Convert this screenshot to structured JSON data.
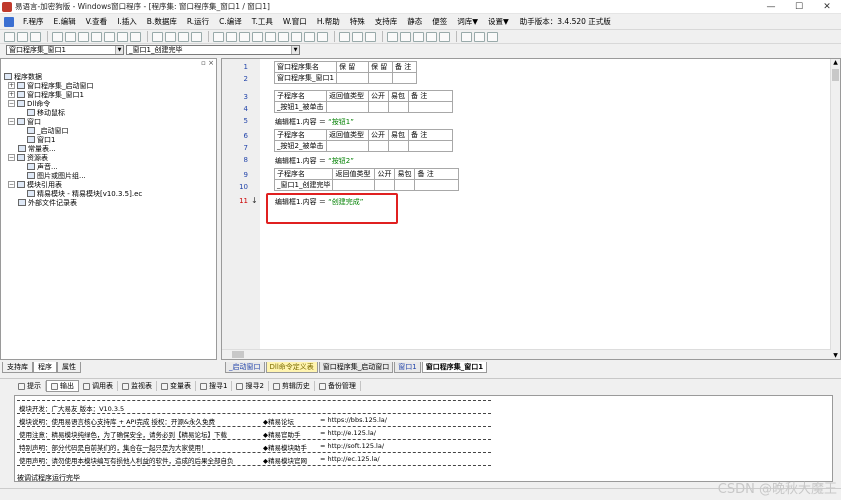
{
  "window": {
    "title": "易语言-加密狗版 - Windows窗口程序 - [程序集: 窗口程序集_窗口1 / 窗口1]",
    "minimize": "—",
    "maximize": "☐",
    "close": "✕"
  },
  "menu": {
    "items": [
      "F.程序",
      "E.编辑",
      "V.查看",
      "I.插入",
      "B.数据库",
      "R.运行",
      "C.编译",
      "T.工具",
      "W.窗口",
      "H.帮助",
      "特殊",
      "支持库",
      "静态",
      "便签",
      "词库▼",
      "设置▼"
    ],
    "version": "助手版本：3.4.520 正式版"
  },
  "combos": {
    "assembly": "窗口程序集_窗口1",
    "subroutine": "_窗口1_创建完毕"
  },
  "tree": {
    "root": "程序数据",
    "items": [
      {
        "label": "窗口程序集_启动窗口"
      },
      {
        "label": "窗口程序集_窗口1"
      },
      {
        "label": "Dll命令"
      },
      {
        "label": "移动鼠标"
      },
      {
        "label": "窗口"
      },
      {
        "label": "_启动窗口"
      },
      {
        "label": "窗口1"
      },
      {
        "label": "常量表..."
      },
      {
        "label": "资源表"
      },
      {
        "label": "声音..."
      },
      {
        "label": "图片或图片组..."
      },
      {
        "label": "模块引用表"
      },
      {
        "label": "精易模块 - 精易模块[v10.3.5].ec"
      },
      {
        "label": "外部文件记录表"
      }
    ]
  },
  "left_tabs": [
    "支持库",
    "程序",
    "属性"
  ],
  "editor": {
    "line_numbers": [
      "1",
      "2",
      "3",
      "4",
      "5",
      "6",
      "7",
      "8",
      "9",
      "10",
      "11"
    ],
    "arrow": "↓",
    "assembly_table": {
      "headers": [
        "窗口程序集名",
        "保 留",
        "保 留",
        "备 注"
      ],
      "values": [
        "窗口程序集_窗口1",
        "",
        "",
        ""
      ]
    },
    "sub_headers": [
      "子程序名",
      "返回值类型",
      "公开",
      "易包",
      "备 注"
    ],
    "subs": [
      {
        "name": "_按钮1_被单击",
        "code_prefix": "编辑框1.内容 ＝ ",
        "code_str": "“按钮1”"
      },
      {
        "name": "_按钮2_被单击",
        "code_prefix": "编辑框1.内容 ＝ ",
        "code_str": "“按钮2”"
      },
      {
        "name": "_窗口1_创建完毕",
        "code_prefix": "编辑框1.内容 ＝ ",
        "code_str": "“创建完成”"
      }
    ]
  },
  "editor_tabs": [
    "_启动窗口",
    "Dll命令定义表",
    "窗口程序集_启动窗口",
    "窗口1",
    "窗口程序集_窗口1"
  ],
  "bottom_tabs": [
    "提示",
    "输出",
    "调用表",
    "监视表",
    "变量表",
    "搜寻1",
    "搜寻2",
    "剪辑历史",
    "备份管理"
  ],
  "output": {
    "rows": [
      {
        "text": "模块开发：广大易友    版本：V10.3.5",
        "right": "",
        "url": ""
      },
      {
        "text": "模块说明：使用易语言核心支持库 + API完成      授权：开源&永久免费",
        "right": "◆精易论坛",
        "url": "=  https://bbs.125.la/"
      },
      {
        "text": "使用注意：精易模块纯绿色，为了确保安全，请务必到【精易论坛】下载",
        "right": "◆精易官助手",
        "url": "=  http://e.125.la/"
      },
      {
        "text": "特别声明：部分代码是自前某们的，集合在一起只是为大家使用！",
        "right": "◆精易模块助手",
        "url": "=  http://soft.125.la/"
      },
      {
        "text": "使用声明：请勿使用本模块编写有损他人利益的软件，造成的后果全部自负",
        "right": "◆精易模块官网",
        "url": "=  http://ec.125.la/"
      }
    ],
    "status": "被调试程序运行完毕"
  },
  "watermark": "CSDN @晚秋大魔王"
}
